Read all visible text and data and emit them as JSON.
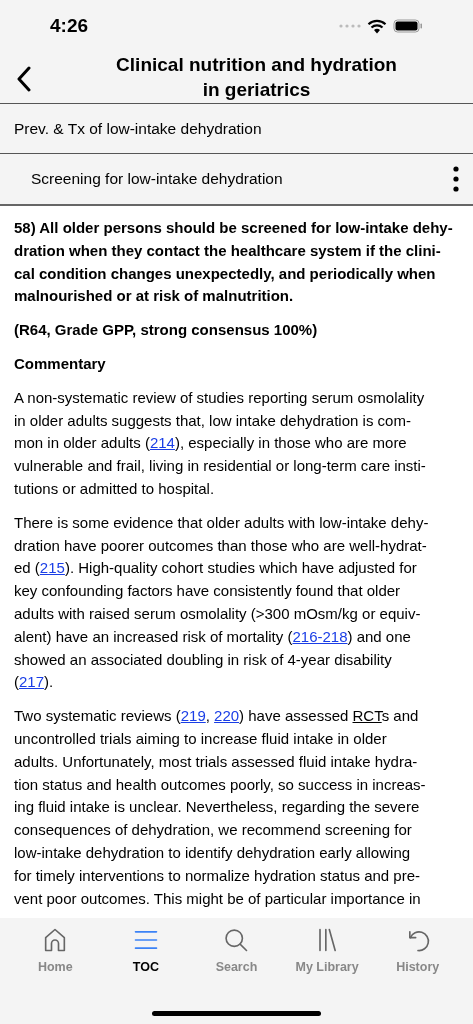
{
  "status_bar": {
    "time": "4:26"
  },
  "header": {
    "title": "Clinical nutrition and hydration in geriatrics"
  },
  "breadcrumb": {
    "parent": "Prev. & Tx of low-intake dehydration",
    "current": "Screening for low-intake dehydration"
  },
  "content": [
    {
      "kind": "bold",
      "lines": [
        [
          {
            "kind": "text",
            "text": "58) All older persons should be screened for low-intake dehy-"
          }
        ],
        [
          {
            "kind": "text",
            "text": "dration when they contact the healthcare system if the clini-"
          }
        ],
        [
          {
            "kind": "text",
            "text": "cal condition changes unexpectedly, and periodically when"
          }
        ],
        [
          {
            "kind": "text",
            "text": "malnourished or at risk of malnutrition."
          }
        ]
      ]
    },
    {
      "kind": "bold",
      "lines": [
        [
          {
            "kind": "text",
            "text": "(R64, Grade GPP, strong consensus 100%)"
          }
        ]
      ]
    },
    {
      "kind": "bold",
      "lines": [
        [
          {
            "kind": "text",
            "text": "Commentary"
          }
        ]
      ]
    },
    {
      "kind": "normal",
      "lines": [
        [
          {
            "kind": "text",
            "text": "A non-systematic review of studies reporting serum osmolality"
          }
        ],
        [
          {
            "kind": "text",
            "text": "in older adults suggests that, low intake dehydration is com-"
          }
        ],
        [
          {
            "kind": "text",
            "text": "mon in older adults ("
          },
          {
            "kind": "link",
            "text": "214"
          },
          {
            "kind": "text",
            "text": "), especially in those who are more"
          }
        ],
        [
          {
            "kind": "text",
            "text": "vulnerable and frail, living in residential or long-term care insti-"
          }
        ],
        [
          {
            "kind": "text",
            "text": "tutions or admitted to hospital."
          }
        ]
      ]
    },
    {
      "kind": "normal",
      "lines": [
        [
          {
            "kind": "text",
            "text": "There is some evidence that older adults with low-intake dehy-"
          }
        ],
        [
          {
            "kind": "text",
            "text": "dration have poorer outcomes than those who are well-hydrat-"
          }
        ],
        [
          {
            "kind": "text",
            "text": "ed ("
          },
          {
            "kind": "link",
            "text": "215"
          },
          {
            "kind": "text",
            "text": "). High-quality cohort studies which have adjusted for"
          }
        ],
        [
          {
            "kind": "text",
            "text": "key confounding factors have consistently found that older"
          }
        ],
        [
          {
            "kind": "text",
            "text": "adults with raised serum osmolality (>300 mOsm/kg or equiv-"
          }
        ],
        [
          {
            "kind": "text",
            "text": "alent) have an increased risk of mortality ("
          },
          {
            "kind": "link",
            "text": "216-218"
          },
          {
            "kind": "text",
            "text": ") and one"
          }
        ],
        [
          {
            "kind": "text",
            "text": "showed an associated doubling in risk of 4-year disability"
          }
        ],
        [
          {
            "kind": "text",
            "text": "("
          },
          {
            "kind": "link",
            "text": "217"
          },
          {
            "kind": "text",
            "text": ")."
          }
        ]
      ]
    },
    {
      "kind": "normal",
      "lines": [
        [
          {
            "kind": "text",
            "text": "Two systematic reviews ("
          },
          {
            "kind": "link",
            "text": "219"
          },
          {
            "kind": "text",
            "text": ", "
          },
          {
            "kind": "link",
            "text": "220"
          },
          {
            "kind": "text",
            "text": ") have assessed "
          },
          {
            "kind": "abbr",
            "text": "RCT"
          },
          {
            "kind": "text",
            "text": "s and"
          }
        ],
        [
          {
            "kind": "text",
            "text": "uncontrolled trials aiming to increase fluid intake in older"
          }
        ],
        [
          {
            "kind": "text",
            "text": "adults. Unfortunately, most trials assessed fluid intake hydra-"
          }
        ],
        [
          {
            "kind": "text",
            "text": "tion status and health outcomes poorly, so success in increas-"
          }
        ],
        [
          {
            "kind": "text",
            "text": "ing fluid intake is unclear. Nevertheless, regarding the severe"
          }
        ],
        [
          {
            "kind": "text",
            "text": "consequences of dehydration, we recommend screening for"
          }
        ],
        [
          {
            "kind": "text",
            "text": "low-intake dehydration to identify dehydration early allowing"
          }
        ],
        [
          {
            "kind": "text",
            "text": "for timely interventions to normalize hydration status and pre-"
          }
        ],
        [
          {
            "kind": "text",
            "text": "vent poor outcomes. This might be of particular importance in"
          }
        ]
      ]
    }
  ],
  "tab_bar": [
    {
      "kind": "home",
      "label": "Home",
      "selected": false
    },
    {
      "kind": "toc",
      "label": "TOC",
      "selected": true
    },
    {
      "kind": "search",
      "label": "Search",
      "selected": false
    },
    {
      "kind": "library",
      "label": "My Library",
      "selected": false
    },
    {
      "kind": "history",
      "label": "History",
      "selected": false
    }
  ]
}
